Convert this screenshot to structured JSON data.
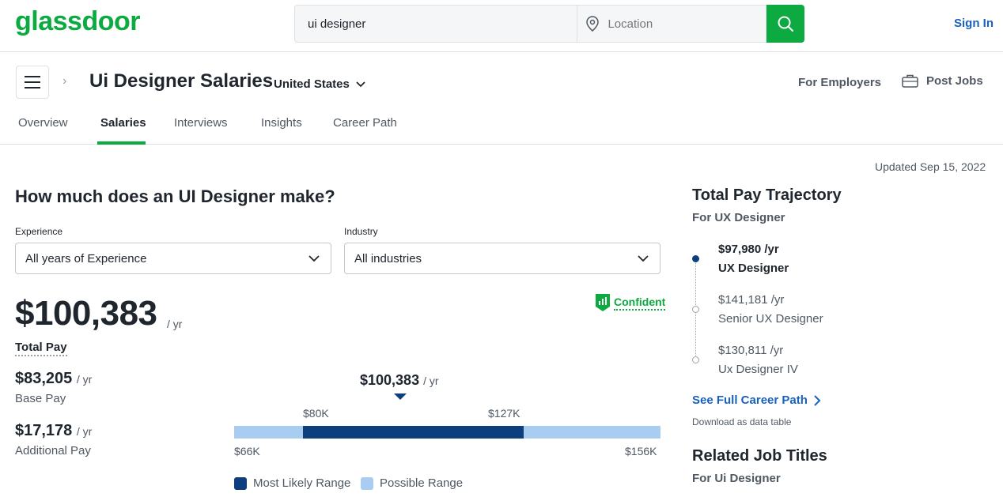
{
  "header": {
    "logo": "glassdoor",
    "search_value": "ui designer",
    "location_placeholder": "Location",
    "sign_in": "Sign In"
  },
  "page": {
    "title": "Ui Designer Salaries",
    "country": "United States",
    "for_employers": "For Employers",
    "post_jobs": "Post Jobs"
  },
  "tabs": [
    {
      "label": "Overview",
      "active": false
    },
    {
      "label": "Salaries",
      "active": true
    },
    {
      "label": "Interviews",
      "active": false
    },
    {
      "label": "Insights",
      "active": false
    },
    {
      "label": "Career Path",
      "active": false
    }
  ],
  "updated": "Updated Sep 15, 2022",
  "salary": {
    "question": "How much does an UI Designer make?",
    "experience_label": "Experience",
    "experience_value": "All years of Experience",
    "industry_label": "Industry",
    "industry_value": "All industries",
    "total_pay": "$100,383",
    "per_year": "/ yr",
    "total_pay_label": "Total Pay",
    "confident": "Confident",
    "base_pay": "$83,205",
    "base_pay_label": "Base Pay",
    "additional_pay": "$17,178",
    "additional_pay_label": "Additional Pay"
  },
  "range": {
    "median": "$100,383",
    "likely_low": "$80K",
    "likely_high": "$127K",
    "possible_low": "$66K",
    "possible_high": "$156K",
    "legend_likely": "Most Likely Range",
    "legend_possible": "Possible Range",
    "color_likely": "#0d3f7d",
    "color_possible": "#a8cdf0"
  },
  "trajectory": {
    "title": "Total Pay Trajectory",
    "subtitle": "For UX Designer",
    "items": [
      {
        "salary": "$97,980 /yr",
        "title": "UX Designer"
      },
      {
        "salary": "$141,181 /yr",
        "title": "Senior UX Designer"
      },
      {
        "salary": "$130,811 /yr",
        "title": "Ux Designer IV"
      }
    ],
    "career_link": "See Full Career Path",
    "download": "Download as data table"
  },
  "related": {
    "title": "Related Job Titles",
    "subtitle": "For Ui Designer"
  },
  "colors": {
    "brand": "#0caa41",
    "link": "#1861bf"
  }
}
